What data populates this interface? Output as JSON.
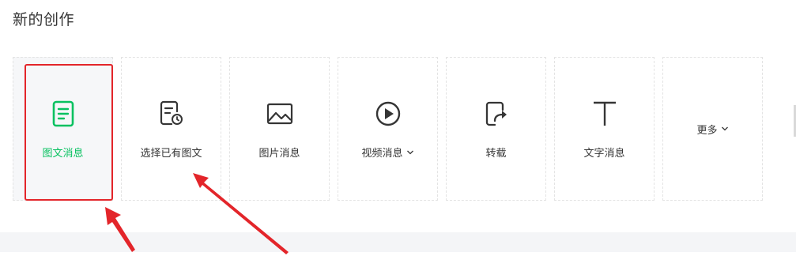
{
  "section": {
    "title": "新的创作"
  },
  "cards": [
    {
      "label": "图文消息",
      "icon": "article-icon",
      "active": true
    },
    {
      "label": "选择已有图文",
      "icon": "existing-article-icon",
      "active": false
    },
    {
      "label": "图片消息",
      "icon": "image-icon",
      "active": false
    },
    {
      "label": "视频消息",
      "icon": "video-play-icon",
      "active": false,
      "has_dropdown": true
    },
    {
      "label": "转载",
      "icon": "repost-icon",
      "active": false
    },
    {
      "label": "文字消息",
      "icon": "text-icon",
      "active": false
    },
    {
      "label": "更多",
      "icon": "chevron-down-icon",
      "active": false,
      "has_dropdown": true
    }
  ],
  "colors": {
    "accent_green": "#07c160",
    "annotation_red": "#e3252a",
    "icon_gray": "#353535"
  }
}
